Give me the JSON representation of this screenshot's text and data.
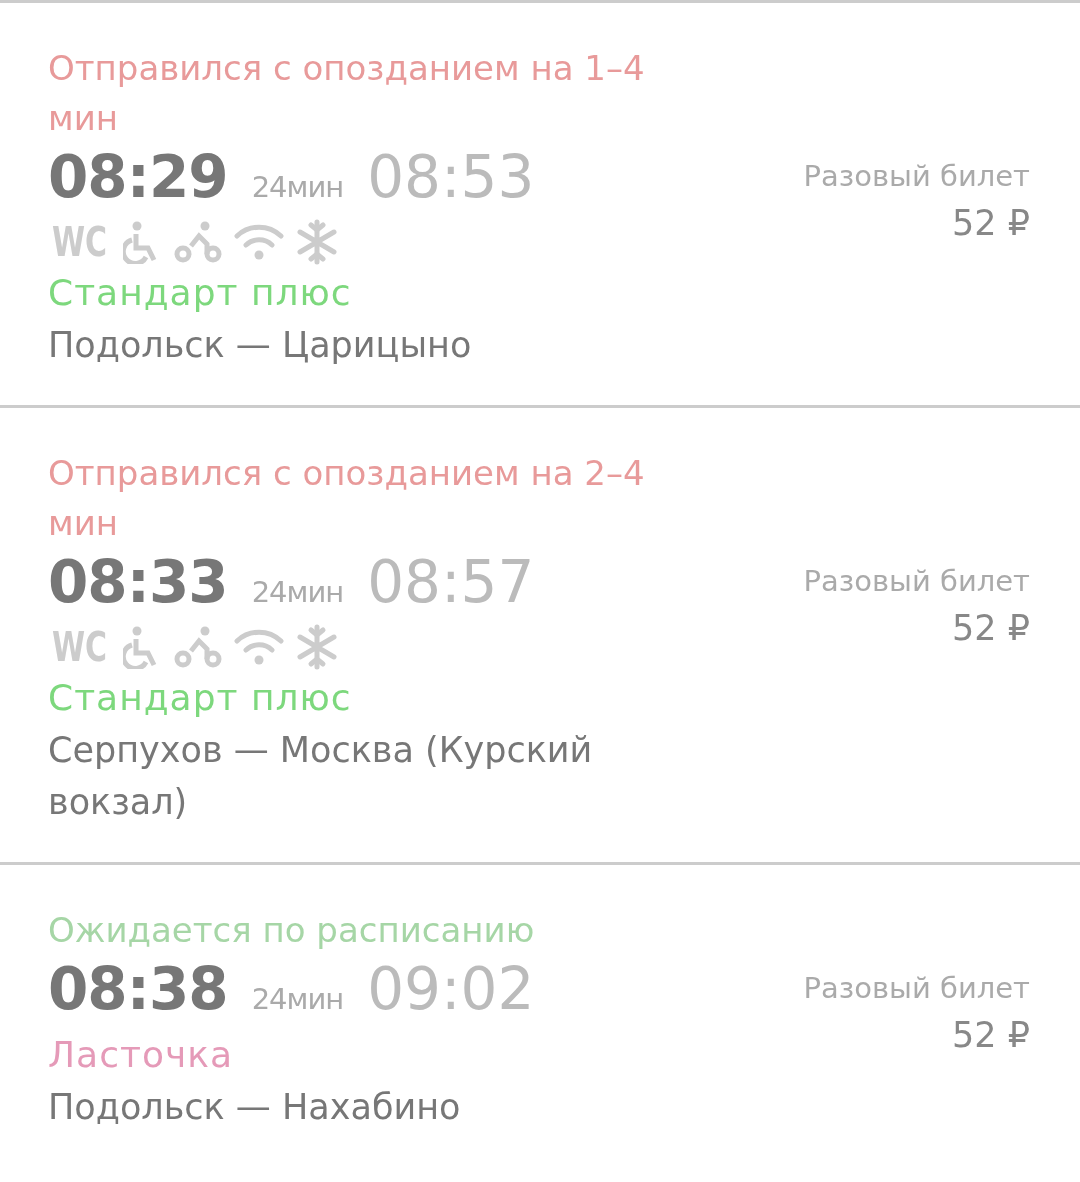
{
  "trains": [
    {
      "status": {
        "kind": "delayed",
        "text": "Отправился с опозданием на 1–4 мин"
      },
      "departure": "08:29",
      "duration": "24мин",
      "arrival": "08:53",
      "amenities": [
        {
          "kind": "wc",
          "text": "WC"
        },
        {
          "kind": "wheelchair"
        },
        {
          "kind": "bicycle"
        },
        {
          "kind": "wifi"
        },
        {
          "kind": "snowflake"
        }
      ],
      "train_type": {
        "text": "Стандарт плюс",
        "color": "#7dd87d"
      },
      "route": "Подольск — Царицыно",
      "ticket": {
        "label": "Разовый билет",
        "price": "52 ₽"
      }
    },
    {
      "status": {
        "kind": "delayed",
        "text": "Отправился с опозданием на 2–4 мин"
      },
      "departure": "08:33",
      "duration": "24мин",
      "arrival": "08:57",
      "amenities": [
        {
          "kind": "wc",
          "text": "WC"
        },
        {
          "kind": "wheelchair"
        },
        {
          "kind": "bicycle"
        },
        {
          "kind": "wifi"
        },
        {
          "kind": "snowflake"
        }
      ],
      "train_type": {
        "text": "Стандарт плюс",
        "color": "#7dd87d"
      },
      "route": "Серпухов — Москва (Курский вокзал)",
      "ticket": {
        "label": "Разовый билет",
        "price": "52 ₽"
      }
    },
    {
      "status": {
        "kind": "on_time",
        "text": "Ожидается по расписанию"
      },
      "departure": "08:38",
      "duration": "24мин",
      "arrival": "09:02",
      "train_type": {
        "text": "Ласточка",
        "color": "#e59ab8"
      },
      "route": "Подольск — Нахабино",
      "ticket": {
        "label": "Разовый билет",
        "price": "52 ₽"
      }
    }
  ]
}
